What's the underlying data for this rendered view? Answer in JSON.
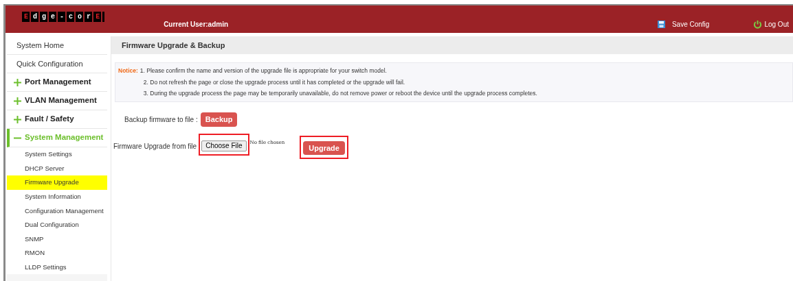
{
  "header": {
    "logo": "Edge-corE",
    "current_user": "Current User:admin",
    "save_config": "Save Config",
    "log_out": "Log Out"
  },
  "sidebar": {
    "items": [
      {
        "kind": "link",
        "label": "System Home"
      },
      {
        "kind": "link",
        "label": "Quick Configuration"
      },
      {
        "kind": "group",
        "label": "Port Management",
        "expanded": false
      },
      {
        "kind": "group",
        "label": "VLAN Management",
        "expanded": false
      },
      {
        "kind": "group",
        "label": "Fault / Safety",
        "expanded": false
      },
      {
        "kind": "group",
        "label": "System Management",
        "expanded": true,
        "children": [
          {
            "label": "System Settings",
            "selected": false
          },
          {
            "label": "DHCP Server",
            "selected": false
          },
          {
            "label": "Firmware Upgrade",
            "selected": true
          },
          {
            "label": "System Information",
            "selected": false
          },
          {
            "label": "Configuration Management",
            "selected": false
          },
          {
            "label": "Dual Configuration",
            "selected": false
          },
          {
            "label": "SNMP",
            "selected": false
          },
          {
            "label": "RMON",
            "selected": false
          },
          {
            "label": "LLDP Settings",
            "selected": false
          }
        ]
      }
    ]
  },
  "panel": {
    "title": "Firmware Upgrade & Backup",
    "notice": {
      "label": "Notice:",
      "lines": [
        "1. Please confirm the name and version of the upgrade file is appropriate for your switch model.",
        "2. Do not refresh the page or close the upgrade process until it has completed or the upgrade will fail.",
        "3. During the upgrade process the page may be temporarily unavailable, do not remove power or reboot the device until the upgrade process completes."
      ]
    },
    "backup": {
      "label": "Backup firmware to file :",
      "button": "Backup"
    },
    "upgrade": {
      "label": "Firmware Upgrade from file",
      "choose_file": {
        "label": "Choose File",
        "highlighted": true
      },
      "file_status": "No file chosen",
      "button": {
        "label": "Upgrade",
        "highlighted": true
      }
    }
  }
}
